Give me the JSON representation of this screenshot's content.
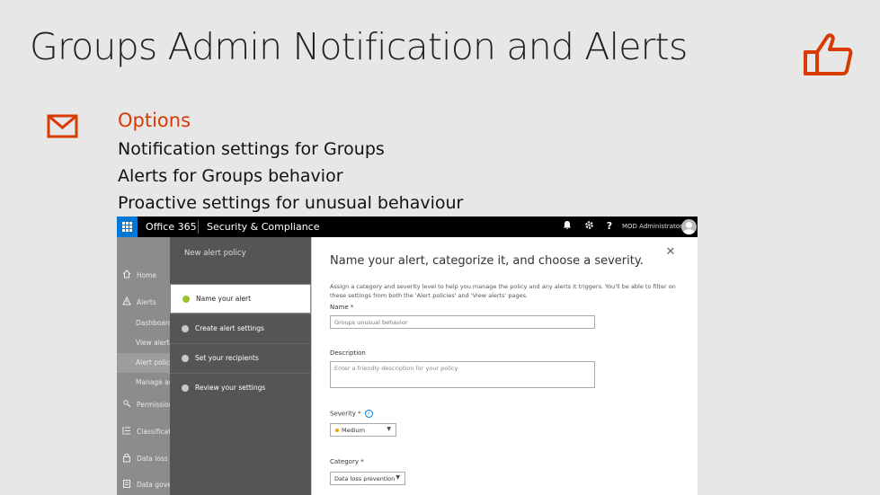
{
  "slide": {
    "title": "Groups Admin Notification and Alerts",
    "options_heading": "Options",
    "options": [
      "Notification settings for Groups",
      "Alerts for Groups behavior",
      "Proactive settings for unusual behaviour"
    ],
    "accent_color": "#d83b01"
  },
  "topbar": {
    "app_name": "Office 365",
    "section": "Security & Compliance",
    "user_name": "MOD Administrator",
    "icons": [
      "waffle-icon",
      "bell-icon",
      "gear-icon",
      "help-icon",
      "avatar"
    ]
  },
  "leftnav": {
    "items": [
      {
        "label": "Home",
        "icon": "home-icon"
      },
      {
        "label": "Alerts",
        "icon": "alert-icon"
      },
      {
        "label": "Dashboard",
        "sub": true
      },
      {
        "label": "View alerts",
        "sub": true
      },
      {
        "label": "Alert policies",
        "sub": true,
        "active": true
      },
      {
        "label": "Manage advanced alerts",
        "sub": true
      },
      {
        "label": "Permissions",
        "icon": "permissions-icon"
      },
      {
        "label": "Classifications",
        "icon": "list-icon"
      },
      {
        "label": "Data loss prevention",
        "icon": "lock-icon"
      },
      {
        "label": "Data governance",
        "icon": "governance-icon"
      }
    ]
  },
  "wizard": {
    "title": "New alert policy",
    "steps": [
      {
        "label": "Name your alert",
        "status": "current"
      },
      {
        "label": "Create alert settings",
        "status": "pending"
      },
      {
        "label": "Set your recipients",
        "status": "pending"
      },
      {
        "label": "Review your settings",
        "status": "pending"
      }
    ]
  },
  "panel": {
    "heading": "Name your alert, categorize it, and choose a severity.",
    "description": "Assign a category and severity level to help you manage the policy and any alerts it triggers. You'll be able to filter on these settings from both the 'Alert policies' and 'View alerts' pages.",
    "name_label": "Name *",
    "name_value": "Groups unusual behavior",
    "description_label": "Description",
    "description_placeholder": "Enter a friendly description for your policy",
    "severity_label": "Severity *",
    "severity_value": "Medium",
    "category_label": "Category *",
    "category_value": "Data loss prevention"
  }
}
